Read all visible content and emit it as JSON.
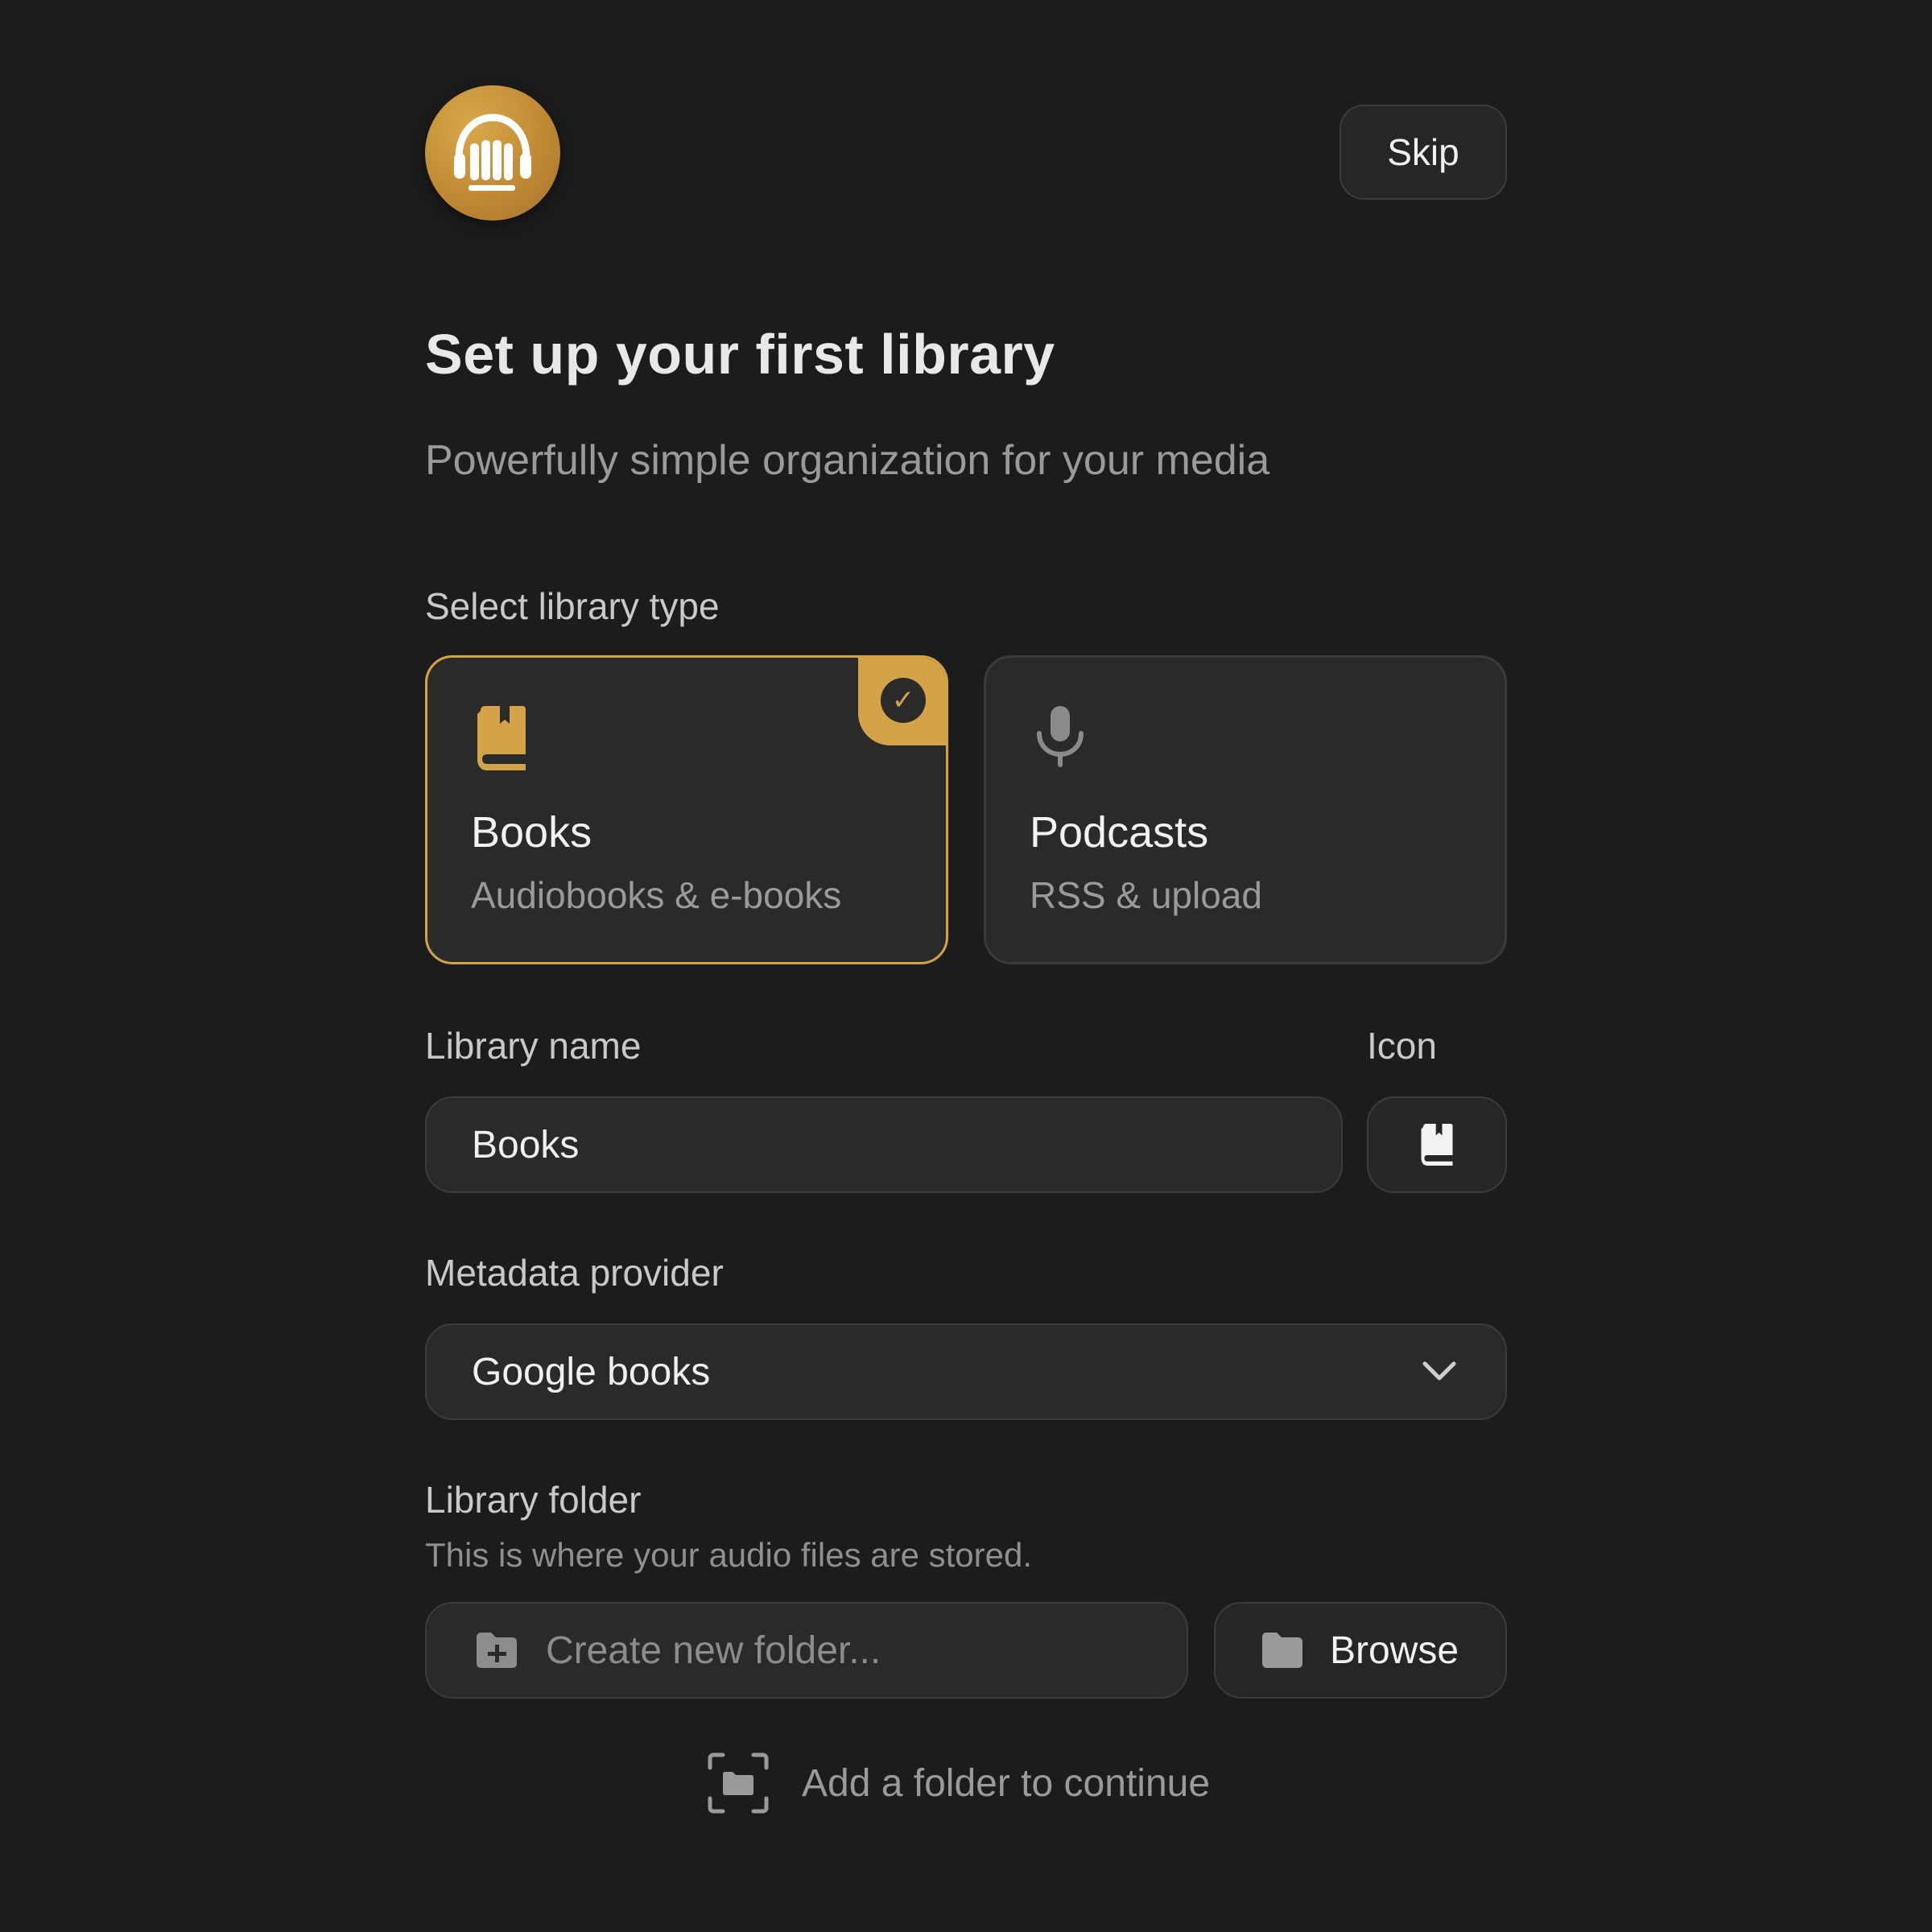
{
  "header": {
    "logo_icon": "headphones-books-icon",
    "skip_label": "Skip"
  },
  "intro": {
    "title": "Set up your first library",
    "subtitle": "Powerfully simple organization for your media"
  },
  "library_type": {
    "label": "Select library type",
    "options": [
      {
        "title": "Books",
        "subtitle": "Audiobooks & e-books",
        "icon": "book-icon",
        "selected": true
      },
      {
        "title": "Podcasts",
        "subtitle": "RSS & upload",
        "icon": "microphone-icon",
        "selected": false
      }
    ],
    "check_mark": "✓"
  },
  "library_name": {
    "label": "Library name",
    "value": "Books"
  },
  "icon_field": {
    "label": "Icon",
    "selected_icon": "book-icon"
  },
  "metadata": {
    "label": "Metadata provider",
    "selected": "Google books"
  },
  "folder": {
    "label": "Library folder",
    "helper": "This is where your audio files are stored.",
    "placeholder": "Create new folder...",
    "browse_label": "Browse"
  },
  "continue_hint": "Add a folder to continue",
  "colors": {
    "accent": "#d4a348",
    "background": "#1c1c1c",
    "card": "#2a2a2a"
  }
}
